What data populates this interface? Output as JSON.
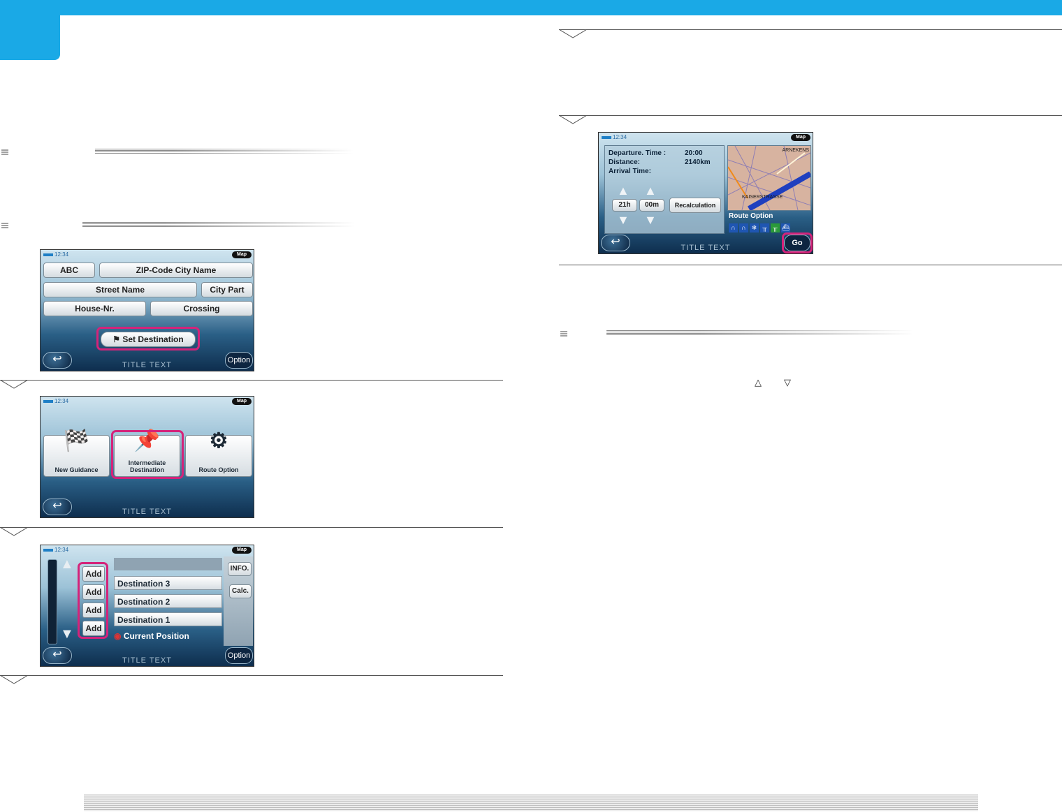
{
  "screen1": {
    "clock": "12:34",
    "map": "Map",
    "buttons": {
      "abc": "ABC",
      "zip": "ZIP-Code City Name",
      "street": "Street Name",
      "city_part": "City Part",
      "house": "House-Nr.",
      "crossing": "Crossing",
      "set_destination": "Set Destination"
    },
    "title": "TITLE TEXT",
    "option": "Option"
  },
  "screen2": {
    "clock": "12:34",
    "map": "Map",
    "tiles": [
      "New Guidance",
      "Intermediate Destination",
      "Route Option"
    ],
    "title": "TITLE TEXT"
  },
  "screen3": {
    "clock": "12:34",
    "map": "Map",
    "add": [
      "Add",
      "Add",
      "Add",
      "Add"
    ],
    "destinations": [
      "Destination 3",
      "Destination 2",
      "Destination 1"
    ],
    "current": "Current Position",
    "info": "INFO.",
    "calc": "Calc.",
    "title": "TITLE TEXT",
    "option": "Option"
  },
  "screen4": {
    "clock": "12:34",
    "map": "Map",
    "departure_label": "Departure. Time :",
    "departure_value": "20:00",
    "distance_label": "Distance:",
    "distance_value": "2140km",
    "arrival_label": "Arrival Time:",
    "hours": "21h",
    "minutes": "00m",
    "recalc": "Recalculation",
    "map_label_top": "ARNEKENS",
    "map_label_street": "KAISERSTRASSE",
    "route_option": "Route Option",
    "title": "TITLE TEXT",
    "go": "Go"
  },
  "arrows": {
    "up": "△",
    "down": "▽"
  }
}
